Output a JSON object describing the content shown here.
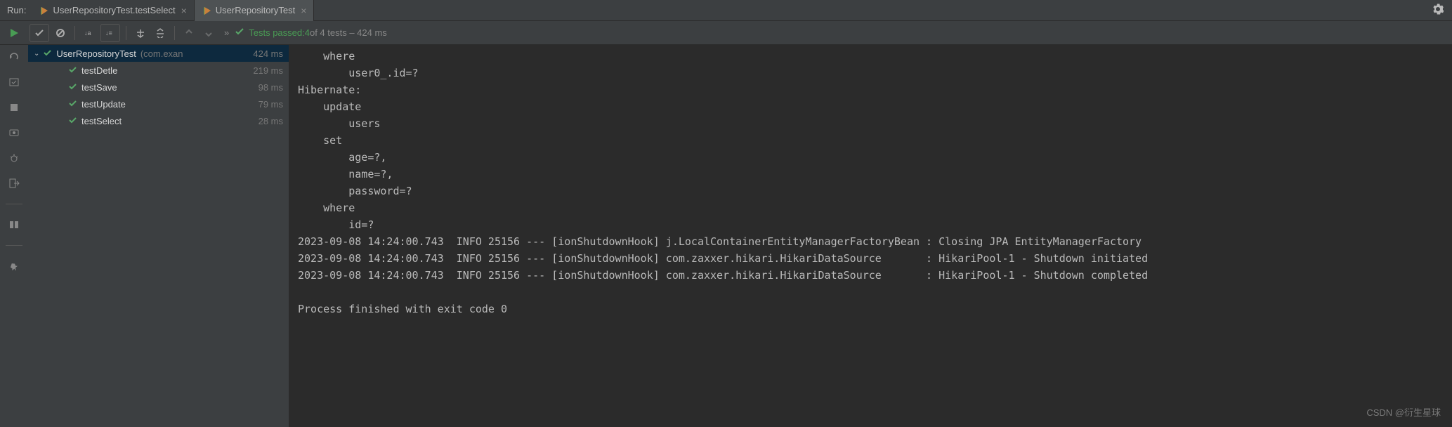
{
  "header": {
    "run_label": "Run:",
    "tabs": [
      {
        "label": "UserRepositoryTest.testSelect",
        "active": false
      },
      {
        "label": "UserRepositoryTest",
        "active": true
      }
    ]
  },
  "status": {
    "prefix": "Tests passed: ",
    "passed_count": "4",
    "of_text": " of 4 tests – 424 ms"
  },
  "tree": {
    "root": {
      "name": "UserRepositoryTest",
      "pkg": "(com.exan",
      "time": "424 ms"
    },
    "children": [
      {
        "name": "testDetle",
        "time": "219 ms"
      },
      {
        "name": "testSave",
        "time": "98 ms"
      },
      {
        "name": "testUpdate",
        "time": "79 ms"
      },
      {
        "name": "testSelect",
        "time": "28 ms"
      }
    ]
  },
  "console_text": "    where\n        user0_.id=?\nHibernate: \n    update\n        users \n    set\n        age=?,\n        name=?,\n        password=? \n    where\n        id=?\n2023-09-08 14:24:00.743  INFO 25156 --- [ionShutdownHook] j.LocalContainerEntityManagerFactoryBean : Closing JPA EntityManagerFactory \n2023-09-08 14:24:00.743  INFO 25156 --- [ionShutdownHook] com.zaxxer.hikari.HikariDataSource       : HikariPool-1 - Shutdown initiated\n2023-09-08 14:24:00.743  INFO 25156 --- [ionShutdownHook] com.zaxxer.hikari.HikariDataSource       : HikariPool-1 - Shutdown completed\n\nProcess finished with exit code 0",
  "watermark": "CSDN @衍生星球",
  "colors": {
    "pass_green": "#59a869",
    "play_green": "#499c54",
    "selection_blue": "#0d293e"
  }
}
